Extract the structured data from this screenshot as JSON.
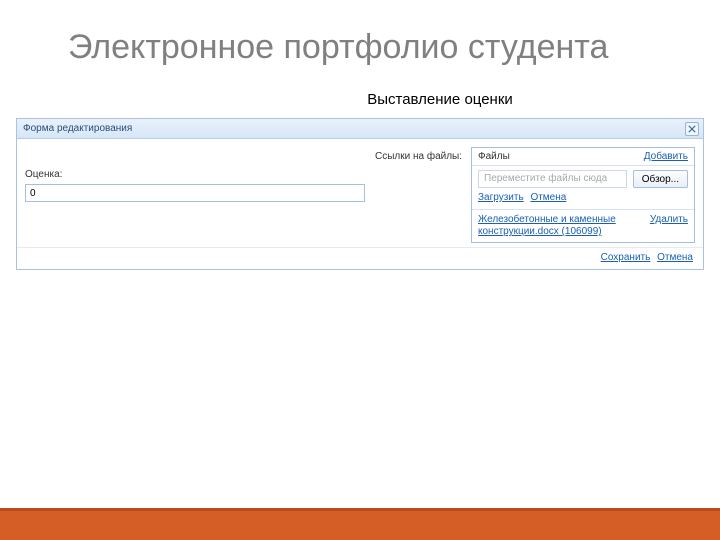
{
  "slide": {
    "title": "Электронное портфолио студента",
    "subtitle": "Выставление оценки"
  },
  "dialog": {
    "title": "Форма редактирования",
    "grade_label": "Оценка:",
    "grade_value": "0",
    "files_label": "Ссылки на файлы:",
    "files_header": "Файлы",
    "add_link": "Добавить",
    "dropzone_placeholder": "Переместите файлы сюда",
    "browse_btn": "Обзор...",
    "upload_link": "Загрузить",
    "cancel_upload_link": "Отмена",
    "file_item_name": "Железобетонные и каменные конструкции.docx (106099)",
    "delete_link": "Удалить",
    "save_btn": "Сохранить",
    "cancel_btn": "Отмена"
  }
}
